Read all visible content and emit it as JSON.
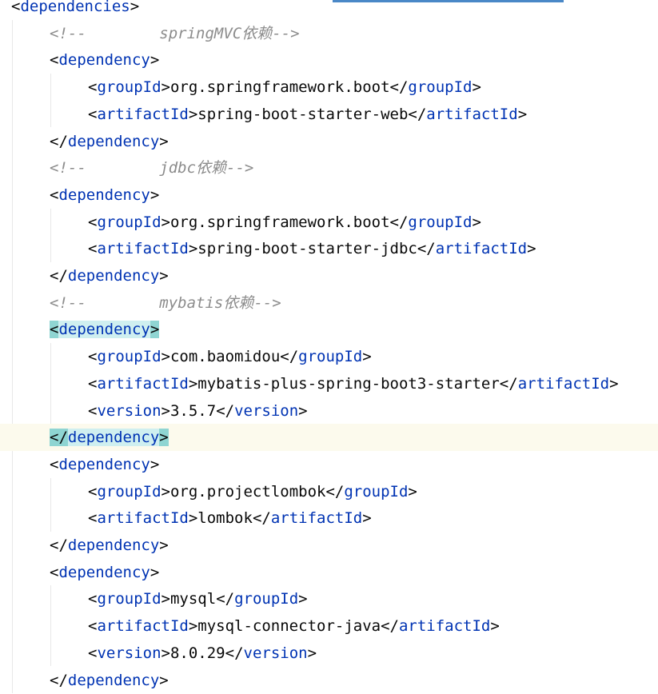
{
  "editor": {
    "lines": [
      {
        "kind": "open",
        "tag": "dependencies"
      },
      {
        "kind": "comment",
        "text": "<!--        springMVC依赖-->"
      },
      {
        "kind": "open",
        "tag": "dependency"
      },
      {
        "kind": "element",
        "tag": "groupId",
        "value": "org.springframework.boot"
      },
      {
        "kind": "element",
        "tag": "artifactId",
        "value": "spring-boot-starter-web"
      },
      {
        "kind": "close",
        "tag": "dependency"
      },
      {
        "kind": "comment",
        "text": "<!--        jdbc依赖-->"
      },
      {
        "kind": "open",
        "tag": "dependency"
      },
      {
        "kind": "element",
        "tag": "groupId",
        "value": "org.springframework.boot"
      },
      {
        "kind": "element",
        "tag": "artifactId",
        "value": "spring-boot-starter-jdbc"
      },
      {
        "kind": "close",
        "tag": "dependency"
      },
      {
        "kind": "comment",
        "text": "<!--        mybatis依赖-->"
      },
      {
        "kind": "open",
        "tag": "dependency",
        "highlight": true
      },
      {
        "kind": "element",
        "tag": "groupId",
        "value": "com.baomidou"
      },
      {
        "kind": "element",
        "tag": "artifactId",
        "value": "mybatis-plus-spring-boot3-starter"
      },
      {
        "kind": "element",
        "tag": "version",
        "value": "3.5.7"
      },
      {
        "kind": "close",
        "tag": "dependency",
        "highlight": true,
        "current": true
      },
      {
        "kind": "open",
        "tag": "dependency"
      },
      {
        "kind": "element",
        "tag": "groupId",
        "value": "org.projectlombok"
      },
      {
        "kind": "element",
        "tag": "artifactId",
        "value": "lombok"
      },
      {
        "kind": "close",
        "tag": "dependency"
      },
      {
        "kind": "open",
        "tag": "dependency"
      },
      {
        "kind": "element",
        "tag": "groupId",
        "value": "mysql"
      },
      {
        "kind": "element",
        "tag": "artifactId",
        "value": "mysql-connector-java"
      },
      {
        "kind": "element",
        "tag": "version",
        "value": "8.0.29"
      },
      {
        "kind": "close",
        "tag": "dependency"
      }
    ]
  }
}
